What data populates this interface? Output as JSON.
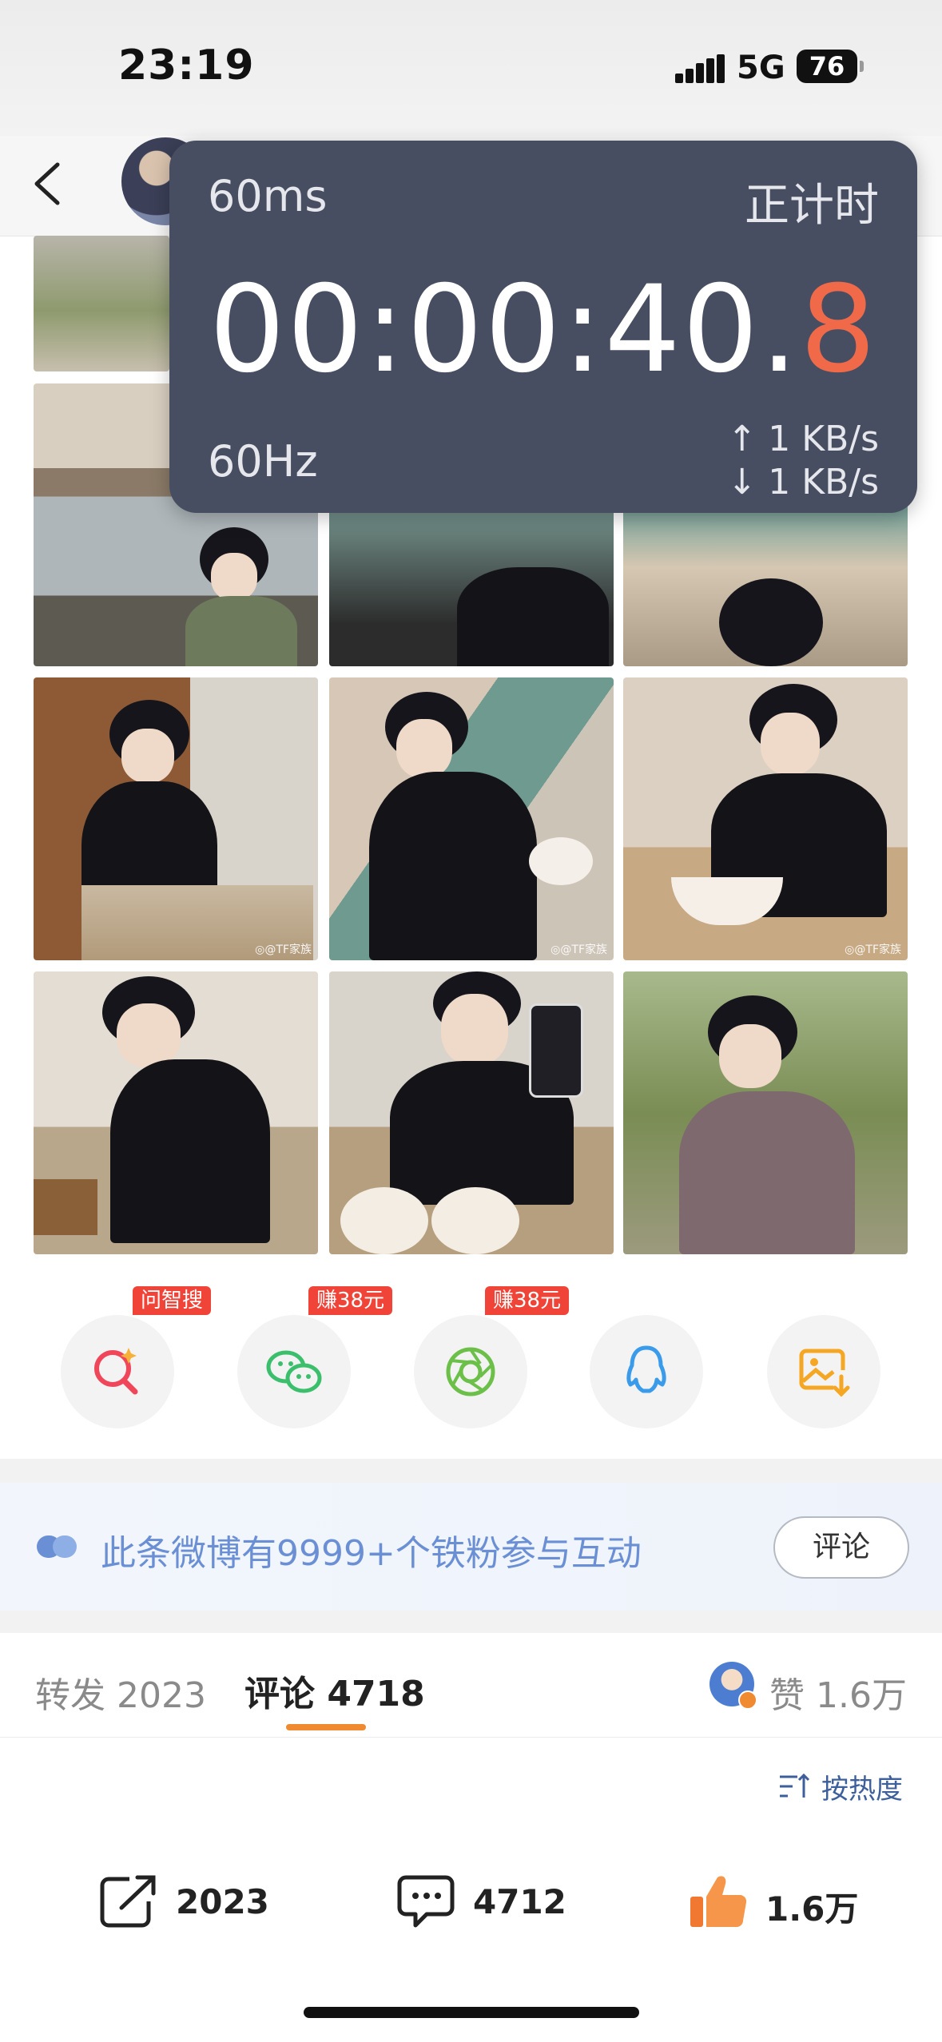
{
  "status_bar": {
    "time": "23:19",
    "network": "5G",
    "battery": "76"
  },
  "timer_overlay": {
    "latency": "60ms",
    "mode": "正计时",
    "clock_main": "00:00:40.",
    "clock_tenth": "8",
    "refresh_rate": "60Hz",
    "upload": "↑ 1 KB/s",
    "download": "↓ 1 KB/s"
  },
  "photos": {
    "watermark": "◎@TF家族"
  },
  "share": {
    "tags": {
      "search": "问智搜",
      "wechat": "赚38元",
      "moments": "赚38元"
    },
    "icons": [
      "search-sparkle-icon",
      "wechat-icon",
      "moments-icon",
      "qq-icon",
      "save-image-icon"
    ]
  },
  "fan_banner": {
    "text": "此条微博有9999+个铁粉参与互动",
    "button": "评论"
  },
  "tabs": {
    "repost_label": "转发",
    "repost_count": "2023",
    "comment_label": "评论",
    "comment_count": "4718",
    "likes_label": "赞",
    "likes_count": "1.6万"
  },
  "sort": {
    "label": "按热度"
  },
  "actions": {
    "repost": "2023",
    "comment": "4712",
    "like": "1.6万"
  },
  "colors": {
    "accent_orange": "#f08a30",
    "timer_bg": "#484e62",
    "tag_red": "#f04438",
    "link_blue": "#6a8fd4"
  }
}
